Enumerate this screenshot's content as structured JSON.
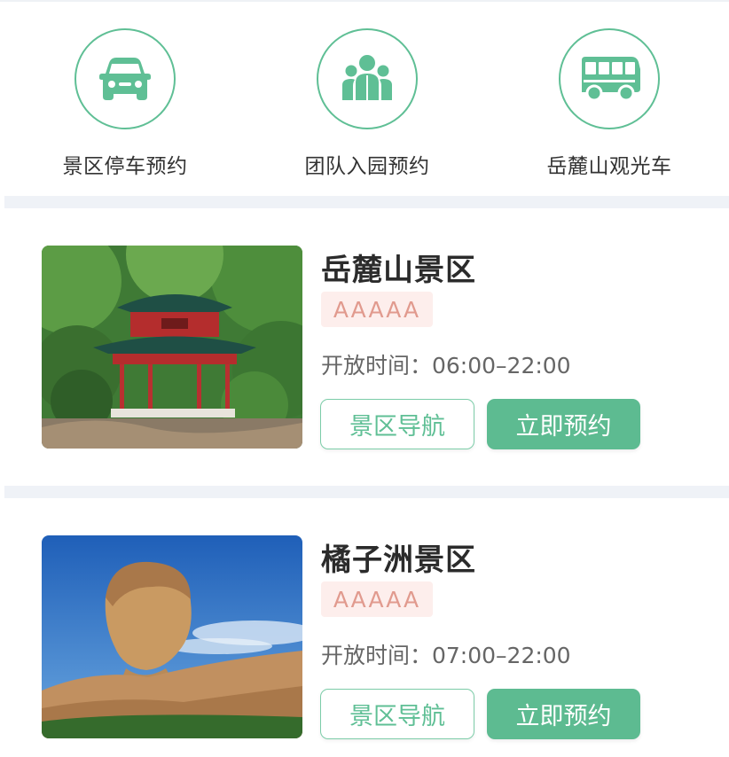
{
  "services": [
    {
      "label": "景区停车预约",
      "icon": "car-icon"
    },
    {
      "label": "团队入园预约",
      "icon": "group-icon"
    },
    {
      "label": "岳麓山观光车",
      "icon": "bus-icon"
    }
  ],
  "colors": {
    "accent": "#5fbf95",
    "button_fill": "#5dbb91",
    "badge_bg": "#fdeeec",
    "badge_text": "#e19a8e",
    "divider": "#eff2f7"
  },
  "scenic_spots": [
    {
      "name": "岳麓山景区",
      "rating": "AAAAA",
      "hours": "开放时间：06:00–22:00",
      "nav_label": "景区导航",
      "book_label": "立即预约",
      "image": "pavilion-photo"
    },
    {
      "name": "橘子洲景区",
      "rating": "AAAAA",
      "hours": "开放时间：07:00–22:00",
      "nav_label": "景区导航",
      "book_label": "立即预约",
      "image": "statue-photo"
    }
  ]
}
